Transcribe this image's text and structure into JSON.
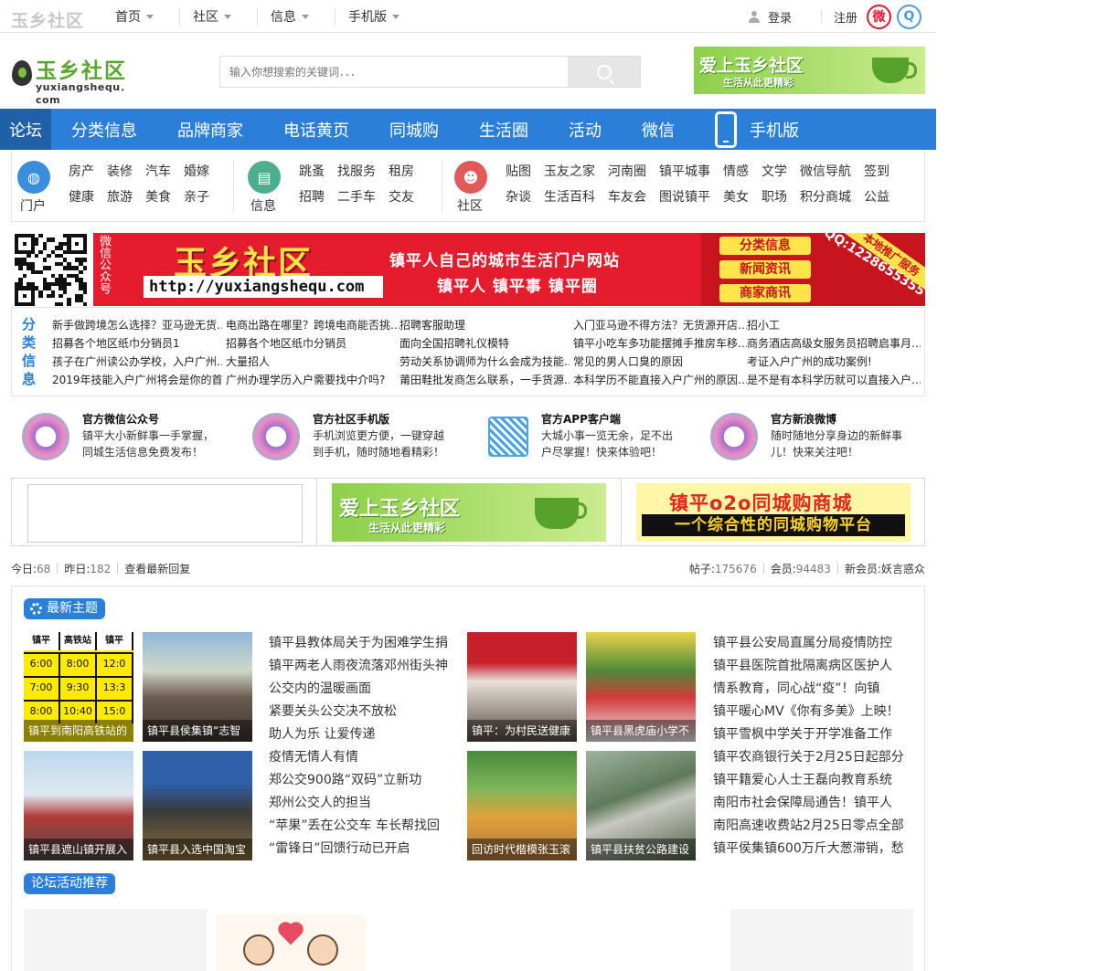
{
  "topbar": {
    "logo": "玉乡社区",
    "nav": [
      "首页",
      "社区",
      "信息",
      "手机版"
    ],
    "login": "登录",
    "register": "注册",
    "weibo_icon": "weibo-icon",
    "qq_icon": "qq-icon"
  },
  "header": {
    "logo_cn": "玉乡社区",
    "logo_en": "yuxiangshequ．com",
    "search_placeholder": "输入你想搜索的关键词．．．",
    "banner_title": "爱上玉乡社区",
    "banner_sub": "生活从此更精彩"
  },
  "mainnav": [
    "论坛",
    "分类信息",
    "品牌商家",
    "电话黄页",
    "同城购",
    "生活圈",
    "活动",
    "微信",
    "手机版"
  ],
  "categories": [
    {
      "label": "门户",
      "links": [
        "房产",
        "健康",
        "装修",
        "旅游",
        "汽车",
        "美食",
        "婚嫁",
        "亲子"
      ]
    },
    {
      "label": "信息",
      "links": [
        "跳蚤",
        "招聘",
        "找服务",
        "二手车",
        "租房",
        "交友"
      ]
    },
    {
      "label": "社区",
      "links": [
        "贴图",
        "杂谈",
        "玉友之家",
        "生活百科",
        "河南圈",
        "车友会",
        "镇平城事",
        "图说镇平",
        "情感",
        "美女",
        "文学",
        "职场",
        "微信导航",
        "积分商城",
        "签到",
        "公益"
      ]
    }
  ],
  "bigbanner": {
    "side": "微信公众号",
    "title": "玉乡社区",
    "url": "http://yuxiangshequ.com",
    "slogan1": "镇平人自己的城市生活门户网站",
    "slogan2": "镇平人 镇平事 镇平圈",
    "tags": [
      "分类信息",
      "新闻资讯",
      "商家商讯"
    ],
    "qq": "QQ:1228655355",
    "ribbon": "本地推广服务"
  },
  "classified": {
    "label": "分类信息",
    "cols": [
      [
        "新手做跨境怎么选择？亚马逊无货…",
        "招募各个地区纸巾分销员1",
        "孩子在广州读公办学校，入户广州…",
        "2019年技能入户广州将会是你的首…"
      ],
      [
        "电商出路在哪里？跨境电商能否挑…",
        "招募各个地区纸巾分销员",
        "大量招人",
        "广州办理学历入户需要找中介吗?"
      ],
      [
        "招聘客服助理",
        "面向全国招聘礼仪模特",
        "劳动关系协调师为什么会成为技能…",
        "莆田鞋批发商怎么联系，一手货源…"
      ],
      [
        "入门亚马逊不得方法？无货源开店…",
        "镇平小吃车多功能摆摊手推房车移…",
        "常见的男人口臭的原因",
        "本科学历不能直接入户广州的原因…"
      ],
      [
        "招小工",
        "商务酒店高级女服务员招聘启事月…",
        "考证入户广州的成功案例!",
        "是不是有本科学历就可以直接入户…"
      ]
    ]
  },
  "official": [
    {
      "title": "官方微信公众号",
      "desc": "镇平大小新鲜事一手掌握，同城生活信息免费发布！"
    },
    {
      "title": "官方社区手机版",
      "desc": "手机浏览更方便，一键穿越到手机，随时随地看精彩！"
    },
    {
      "title": "官方APP客户端",
      "desc": "大城小事一览无余，足不出户尽掌握！快来体验吧！"
    },
    {
      "title": "官方新浪微博",
      "desc": "随时随地分享身边的新鲜事儿！快来关注吧！"
    }
  ],
  "ads": {
    "ad2_title": "爱上玉乡社区",
    "ad2_sub": "生活从此更精彩",
    "ad3_title": "镇平o2o同城购商城",
    "ad3_sub": "一个综合性的同城购物平台"
  },
  "stats": {
    "today_label": "今日:",
    "today": "68",
    "yesterday_label": "昨日:",
    "yesterday": "182",
    "latest_reply": "查看最新回复",
    "posts_label": "帖子:",
    "posts": "175676",
    "members_label": "会员:",
    "members": "94483",
    "newmember_label": "新会员:",
    "newmember": "妖言惑众"
  },
  "latest": {
    "title": "最新主题",
    "timetable": {
      "head": [
        "镇平",
        "高铁站",
        "镇平"
      ],
      "rows": [
        [
          "6:00",
          "8:00",
          "12:0"
        ],
        [
          "7:00",
          "9:30",
          "13:3"
        ],
        [
          "8:00",
          "10:40",
          "15:0"
        ]
      ]
    },
    "thumbs_left": [
      "镇平到南阳高铁站的",
      "镇平县侯集镇“志智",
      "镇平县遮山镇开展入",
      "镇平县入选中国淘宝"
    ],
    "news_left": [
      "镇平县教体局关于为困难学生捐",
      "镇平两老人雨夜流落邓州街头神",
      "公交内的温暖画面",
      "紧要关头公交决不放松",
      "助人为乐 让爱传递",
      "疫情无情人有情",
      "郑公交900路“双码”立新功",
      "郑州公交人的担当",
      "“苹果”丢在公交车 车长帮找回",
      "“雷锋日”回馈行动已开启"
    ],
    "thumbs_right": [
      "镇平：为村民送健康",
      "镇平县黑虎庙小学不",
      "回访时代楷模张玉滚",
      "镇平县扶贫公路建设"
    ],
    "news_right": [
      "镇平县公安局直属分局疫情防控",
      "镇平县医院首批隔离病区医护人",
      "情系教育，同心战“疫”！向镇",
      "镇平暖心MV《你有多美》上映！",
      "镇平雪枫中学关于开学准备工作",
      "镇平农商银行关于2月25日起部分",
      "镇平籍爱心人士王磊向教育系统",
      "南阳市社会保障局通告！镇平人",
      "南阳高速收费站2月25日零点全部",
      "镇平侯集镇600万斤大葱滞销，愁"
    ]
  },
  "activity": {
    "title": "论坛活动推荐"
  }
}
